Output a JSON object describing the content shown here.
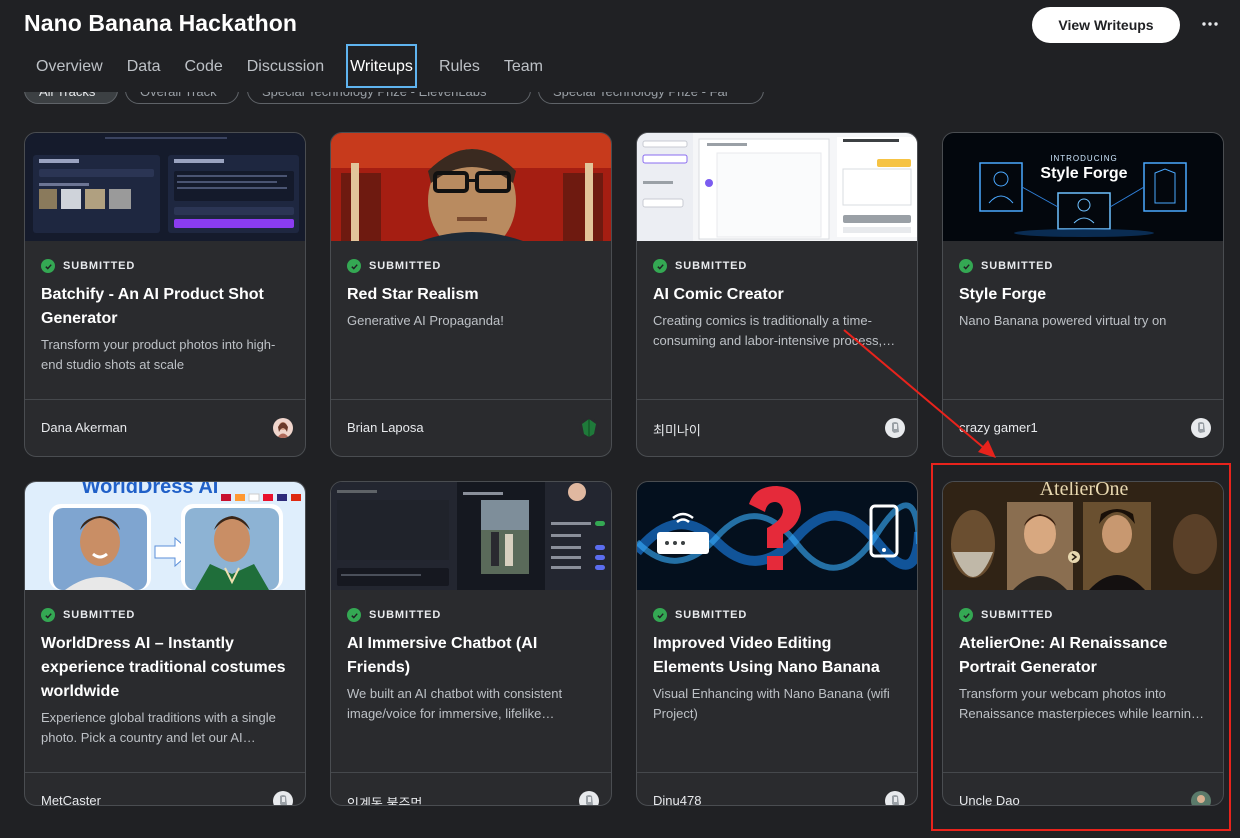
{
  "header": {
    "title": "Nano Banana Hackathon",
    "view_writeups": "View Writeups"
  },
  "tabs": [
    "Overview",
    "Data",
    "Code",
    "Discussion",
    "Writeups",
    "Rules",
    "Team"
  ],
  "active_tab": "Writeups",
  "filter_pills": [
    "All Tracks",
    "Overall Track",
    "Special Technology Prize - ElevenLabs",
    "Special Technology Prize - Fal"
  ],
  "cards": [
    {
      "status": "SUBMITTED",
      "title": "Batchify - An AI Product Shot Generator",
      "subtitle": "Transform your product photos into high-end studio shots at scale",
      "author": "Dana Akerman"
    },
    {
      "status": "SUBMITTED",
      "title": "Red Star Realism",
      "subtitle": "Generative AI Propaganda!",
      "author": "Brian Laposa"
    },
    {
      "status": "SUBMITTED",
      "title": "AI Comic Creator",
      "subtitle": "Creating comics is traditionally a time-consuming and labor-intensive process,…",
      "author": "최미나이"
    },
    {
      "status": "SUBMITTED",
      "title": "Style Forge",
      "subtitle": "Nano Banana powered virtual try on",
      "author": "crazy gamer1"
    },
    {
      "status": "SUBMITTED",
      "title": "WorldDress AI – Instantly experience traditional costumes worldwide",
      "subtitle": "Experience global traditions with a single photo. Pick a country and let our AI…",
      "author": "MetCaster"
    },
    {
      "status": "SUBMITTED",
      "title": "AI Immersive Chatbot (AI Friends)",
      "subtitle": "We built an AI chatbot with consistent image/voice for immersive, lifelike…",
      "author": "인계동 불주먹"
    },
    {
      "status": "SUBMITTED",
      "title": "Improved Video Editing Elements Using Nano Banana",
      "subtitle": "Visual Enhancing with Nano Banana (wifi Project)",
      "author": "Dinu478"
    },
    {
      "status": "SUBMITTED",
      "title": "AtelierOne: AI Renaissance Portrait Generator",
      "subtitle": "Transform your webcam photos into Renaissance masterpieces while learnin…",
      "author": "Uncle Dao"
    }
  ],
  "thumb_text": {
    "style_forge_intro": "INTRODUCING",
    "style_forge_name": "Style Forge",
    "worlddress": "WorldDress AI",
    "atelier": "AtelierOne"
  },
  "colors": {
    "background": "#202124",
    "card": "#2a2b2e",
    "status_green": "#34a853",
    "annotation_red": "#e8231c",
    "tab_focus": "#5fb4f0"
  }
}
